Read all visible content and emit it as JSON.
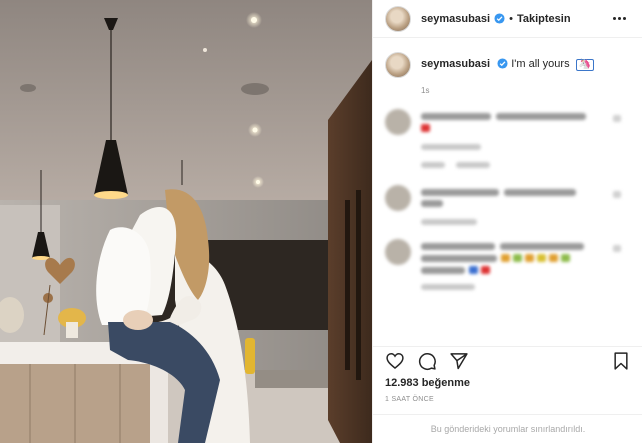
{
  "post": {
    "username": "seymasubasi",
    "follow_status": "Takiptesin",
    "separator": "•",
    "photo_alt": "",
    "colors": {
      "verified": "#3897f0",
      "text": "#262626",
      "muted": "#8e8e8e"
    }
  },
  "caption": {
    "username": "seymasubasi",
    "text": "I'm all yours",
    "emoji": "unicorn-emoji",
    "time": "1s"
  },
  "comments": [
    {
      "blurred": true,
      "icon": "red-heart-emoji"
    },
    {
      "blurred": true
    },
    {
      "blurred": true,
      "icon": "colored-emoji-row"
    }
  ],
  "likes": "12.983 beğenme",
  "age": "1 SAAT ÖNCE",
  "comments_restricted": "Bu gönderideki yorumlar sınırlandırıldı.",
  "icons": [
    "heart-icon",
    "comment-icon",
    "share-icon",
    "bookmark-icon",
    "more-icon",
    "verified-icon"
  ]
}
